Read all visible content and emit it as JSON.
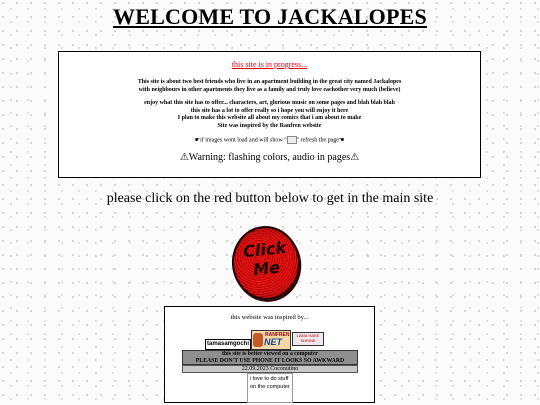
{
  "page": {
    "title": "WELCOME TO JACKALOPES",
    "background_color": "#fbfbfb"
  },
  "info": {
    "progress_link": "this site is in progress...",
    "para1_line1": "This site is about two best friends who live in an apartment building in the great city named Jackalopes",
    "para1_line2": "with neighbours in other apartments they live as a family and truly love eachother very much (believe)",
    "para2_line1": "enjoy what this site has to offer... characters, art, glorious music on some pages and blah blah blah",
    "para2_line2": "this site has a lot to offer really so i hope you will enjoy it here",
    "para2_line3": "I plan to make this website all about my comics that i am about to make",
    "para2_line4": "Site was inspired by the Ranfren website",
    "images_note_prefix": "☛if images wont load and will show \"",
    "images_note_suffix": "\" refresh the page☚",
    "warning": "⚠Warning: flashing colors, audio in pages⚠",
    "accent_color": "#e0000f"
  },
  "cta": {
    "text": "please click on the red button below to get in the main site",
    "button_line1": "Click",
    "button_line2": "Me"
  },
  "inspired": {
    "title": "this website was inspired by...",
    "badge_tamasamgochi": "tamasamgochi",
    "badge_ranfren_top": "RANFREN",
    "badge_ranfren_main": "NET",
    "badge_shrine": "LAMA HAKE SHRINE",
    "bar1_line1": "this site is better viewed on a computer",
    "bar1_line2": "PLEASE DON'T USE PHONE IT LOOKS SO AWKWARD",
    "date_line": "22.09.2023 Coconutino",
    "scroll_text": "i love to do stuff on the computer"
  }
}
